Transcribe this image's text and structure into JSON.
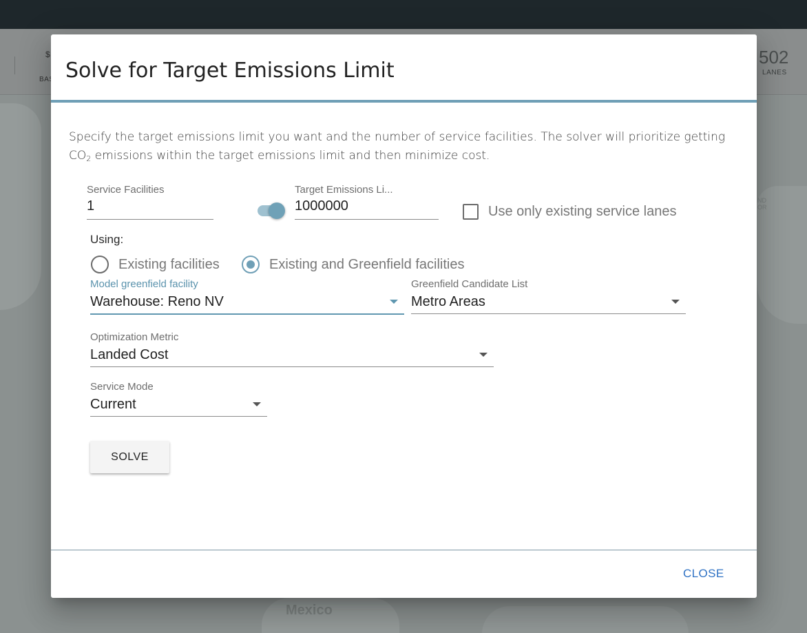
{
  "background": {
    "stat_left_value": "$",
    "stat_left_label": "BAS",
    "stat_right_value": "502",
    "stat_right_label": "LANES",
    "map_label_country": "Mexico",
    "map_label_partial": "ND\nOR"
  },
  "dialog": {
    "title": "Solve for Target Emissions Limit",
    "intro_part1": "Specify the target emissions limit you want and the number of service facilities. The solver will prioritize getting CO",
    "intro_sub": "2",
    "intro_part2": " emissions within the target emissions limit and then minimize cost.",
    "service_facilities": {
      "label": "Service Facilities",
      "value": "1"
    },
    "toggle_on": true,
    "target_emissions": {
      "label": "Target Emissions Li...",
      "value": "1000000"
    },
    "existing_lanes_checkbox": {
      "label": "Use only existing service lanes",
      "checked": false
    },
    "using_label": "Using:",
    "radios": [
      {
        "label": "Existing facilities",
        "checked": false
      },
      {
        "label": "Existing and Greenfield facilities",
        "checked": true
      }
    ],
    "model_greenfield": {
      "label": "Model greenfield facility",
      "value": "Warehouse: Reno NV"
    },
    "greenfield_list": {
      "label": "Greenfield Candidate List",
      "value": "Metro Areas"
    },
    "optimization_metric": {
      "label": "Optimization Metric",
      "value": "Landed Cost"
    },
    "service_mode": {
      "label": "Service Mode",
      "value": "Current"
    },
    "solve_label": "SOLVE",
    "close_label": "CLOSE"
  },
  "colors": {
    "accent": "#6f9fb6",
    "link": "#2f72c4",
    "topbar": "#1e272b"
  }
}
